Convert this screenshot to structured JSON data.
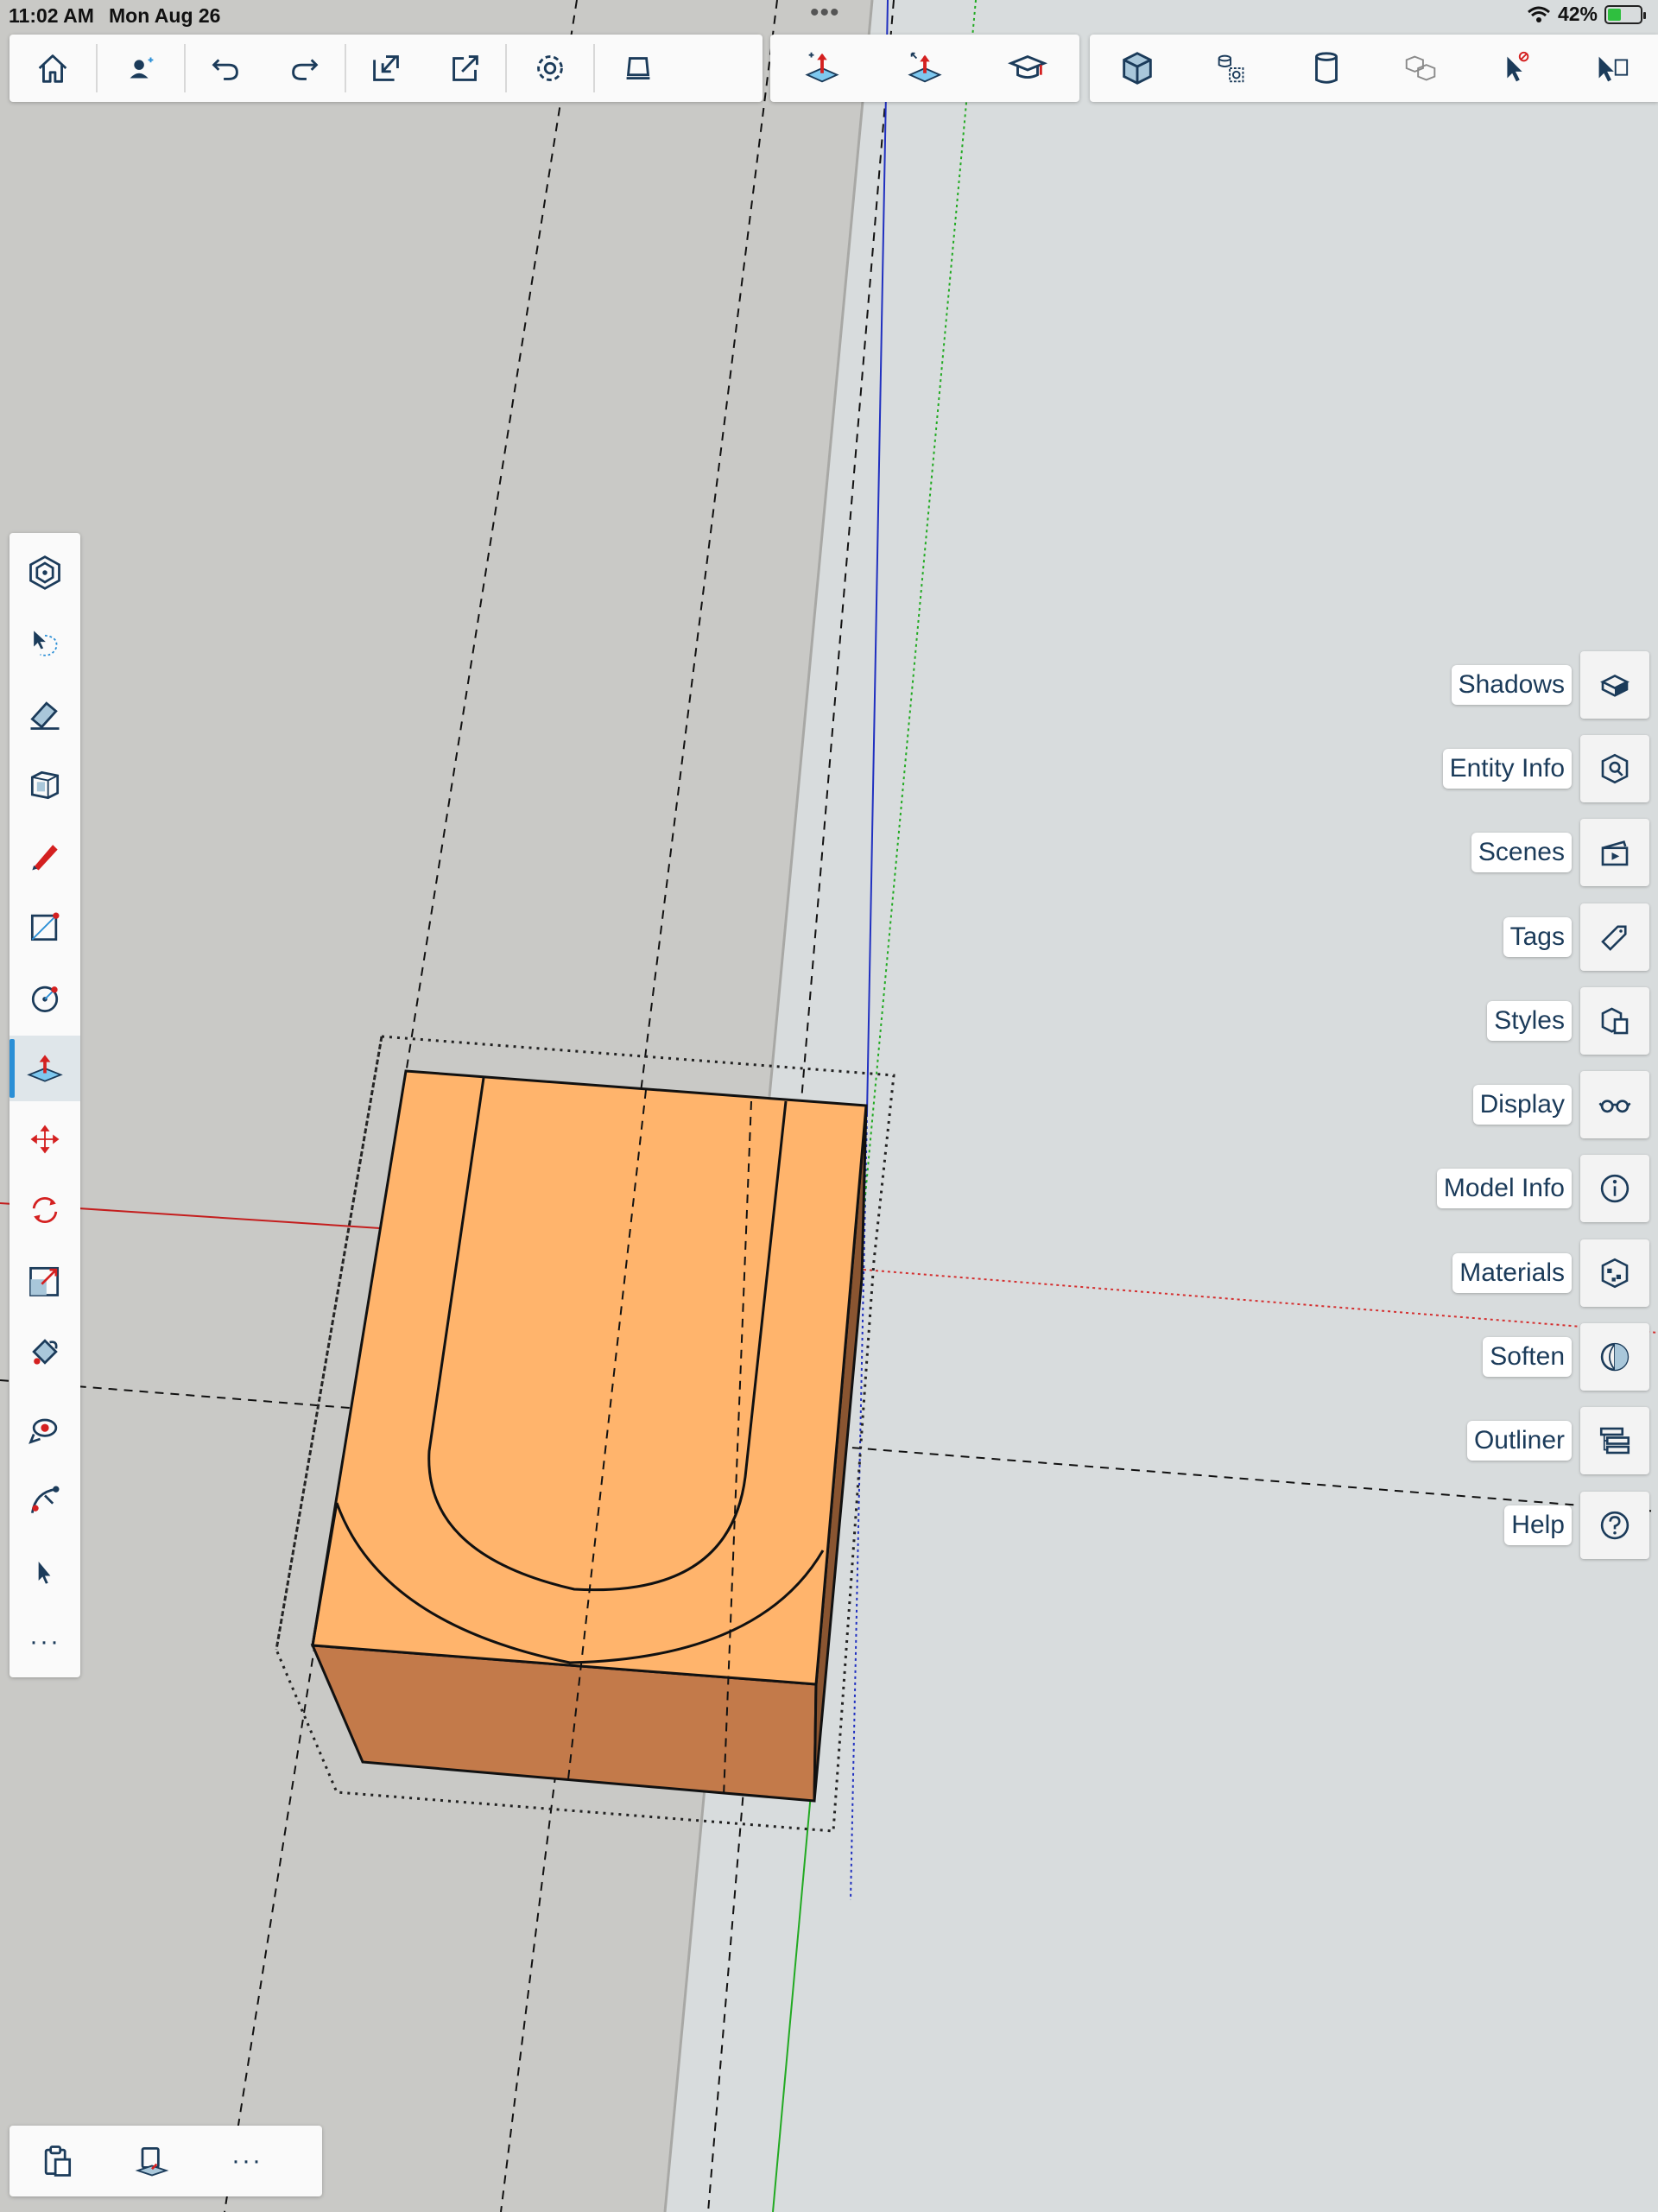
{
  "status_bar": {
    "time": "11:02 AM",
    "date": "Mon Aug 26",
    "battery_percent": "42%",
    "battery_level": 0.42,
    "multitask_dots": "•••"
  },
  "toolbar_main": [
    {
      "name": "home-icon",
      "tooltip": "Home"
    },
    {
      "name": "account-icon",
      "tooltip": "Account"
    },
    {
      "name": "undo-icon",
      "tooltip": "Undo"
    },
    {
      "name": "redo-icon",
      "tooltip": "Redo"
    },
    {
      "name": "import-icon",
      "tooltip": "Import"
    },
    {
      "name": "export-icon",
      "tooltip": "Export"
    },
    {
      "name": "settings-icon",
      "tooltip": "Settings"
    },
    {
      "name": "ar-viewer-icon",
      "tooltip": "View in AR"
    }
  ],
  "toolbar_tools": [
    {
      "name": "push-pull-plus-icon"
    },
    {
      "name": "push-pull-arrows-icon"
    },
    {
      "name": "learn-icon"
    }
  ],
  "toolbar_views": [
    {
      "name": "solid-view-icon"
    },
    {
      "name": "component-icon"
    },
    {
      "name": "cylinder-icon"
    },
    {
      "name": "group-icon"
    },
    {
      "name": "select-none-icon"
    },
    {
      "name": "clipped-icon"
    }
  ],
  "left_tools": [
    {
      "name": "search-3d-warehouse-icon"
    },
    {
      "name": "lasso-select-icon"
    },
    {
      "name": "eraser-icon"
    },
    {
      "name": "solid-tools-icon"
    },
    {
      "name": "pencil-icon"
    },
    {
      "name": "rectangle-icon"
    },
    {
      "name": "circle-icon"
    },
    {
      "name": "push-pull-icon",
      "active": true
    },
    {
      "name": "move-icon"
    },
    {
      "name": "rotate-icon"
    },
    {
      "name": "scale-icon"
    },
    {
      "name": "paint-bucket-icon"
    },
    {
      "name": "orbit-icon"
    },
    {
      "name": "tape-measure-icon"
    },
    {
      "name": "select-icon"
    },
    {
      "name": "more-tools-icon"
    }
  ],
  "right_panels": [
    {
      "label": "Shadows",
      "icon": "shadows-icon"
    },
    {
      "label": "Entity Info",
      "icon": "entity-info-icon"
    },
    {
      "label": "Scenes",
      "icon": "scenes-icon"
    },
    {
      "label": "Tags",
      "icon": "tags-icon"
    },
    {
      "label": "Styles",
      "icon": "styles-icon"
    },
    {
      "label": "Display",
      "icon": "display-icon"
    },
    {
      "label": "Model Info",
      "icon": "model-info-icon"
    },
    {
      "label": "Materials",
      "icon": "materials-icon"
    },
    {
      "label": "Soften",
      "icon": "soften-icon"
    },
    {
      "label": "Outliner",
      "icon": "outliner-icon"
    },
    {
      "label": "Help",
      "icon": "help-icon"
    }
  ],
  "bottom_tools": [
    {
      "name": "clipboard-icon"
    },
    {
      "name": "paste-in-place-icon"
    },
    {
      "name": "more-icon",
      "text": "···"
    }
  ],
  "colors": {
    "ground": "#c9c9c6",
    "sky": "#d8dcdd",
    "model_top": "#ffb46c",
    "model_side": "#c37a4a",
    "axis_red": "#d42020",
    "axis_green": "#22aa22",
    "axis_blue": "#2030c0",
    "ui_icon": "#1b3b5a",
    "accent": "#2b8fd6"
  }
}
